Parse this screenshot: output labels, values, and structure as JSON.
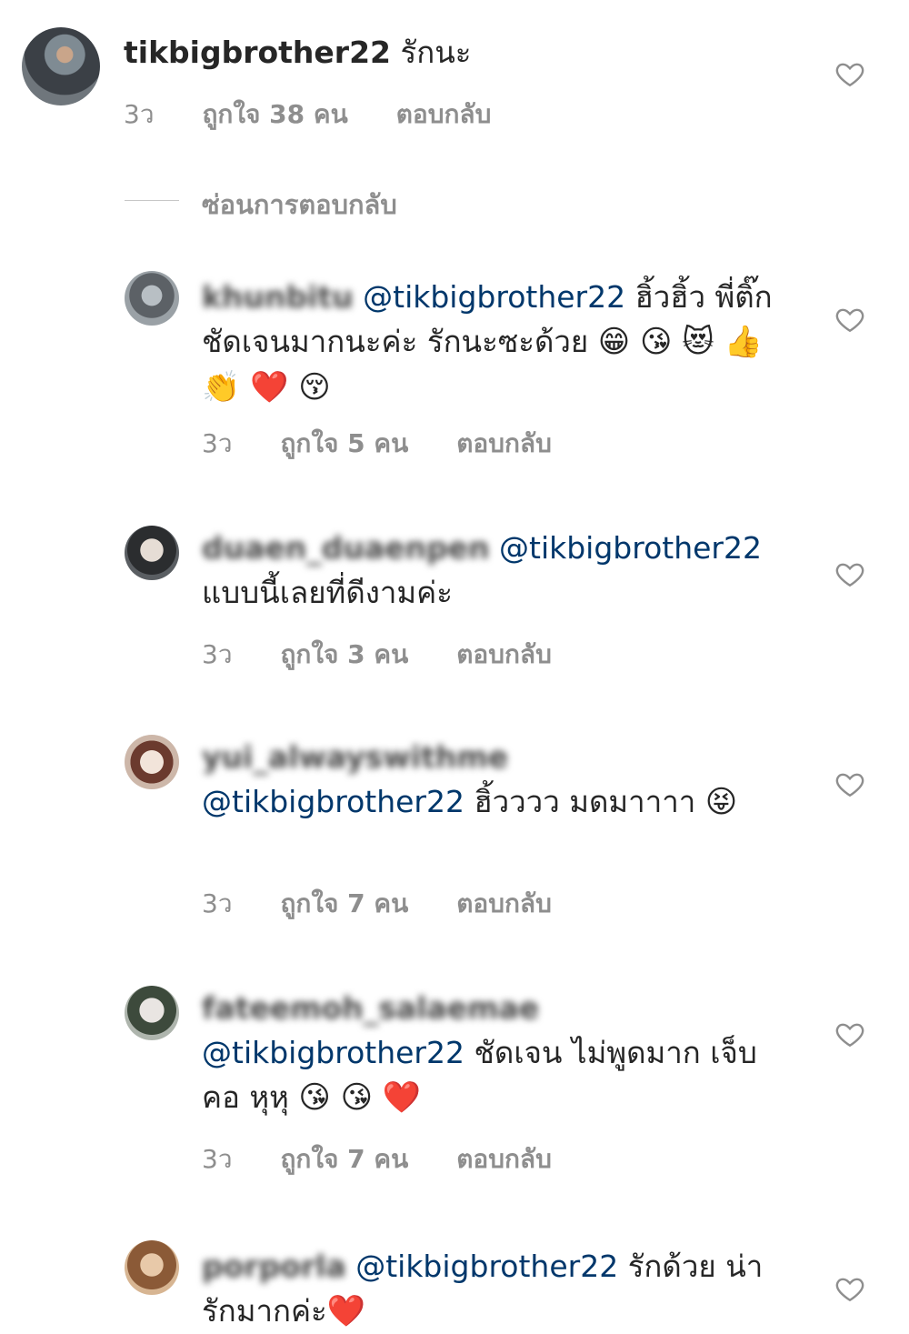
{
  "main_comment": {
    "username": "tikbigbrother22",
    "text": "รักนะ",
    "time": "3ว",
    "likes": "ถูกใจ 38 คน",
    "reply": "ตอบกลับ"
  },
  "hide_replies": "ซ่อนการตอบกลับ",
  "replies": [
    {
      "username": "khunbitu",
      "mention": "@tikbigbrother22",
      "text": "ฮิ้วฮิ้ว พี่ติ๊ก ชัดเจนมากนะค่ะ รักนะซะด้วย",
      "emojis": "😁 😘 😻 👍 👏 ❤️ 😚",
      "time": "3ว",
      "likes": "ถูกใจ 5 คน",
      "reply": "ตอบกลับ"
    },
    {
      "username": "duaen_duaenpen",
      "mention": "@tikbigbrother22",
      "text": "แบบนี้เลยที่ดีงามค่ะ",
      "emojis": "",
      "time": "3ว",
      "likes": "ถูกใจ 3 คน",
      "reply": "ตอบกลับ"
    },
    {
      "username": "yui_alwayswithme",
      "mention": "@tikbigbrother22",
      "text": "ฮิ้วววว มดมาาาา",
      "emojis": "😝",
      "time": "3ว",
      "likes": "ถูกใจ 7 คน",
      "reply": "ตอบกลับ"
    },
    {
      "username": "fateemoh_salaemae",
      "mention": "@tikbigbrother22",
      "text": "ชัดเจน ไม่พูดมาก เจ็บคอ หุหุ",
      "emojis": "😘 😘 ❤️",
      "time": "3ว",
      "likes": "ถูกใจ 7 คน",
      "reply": "ตอบกลับ"
    },
    {
      "username": "porporla",
      "mention": "@tikbigbrother22",
      "text": "รักด้วย น่ารักมากค่ะ",
      "emojis": "❤️",
      "time": "",
      "likes": "",
      "reply": ""
    }
  ],
  "icons": {
    "heart": "heart-outline-icon",
    "heart_color": "#8e8e8e",
    "mention_color": "#00376b"
  }
}
